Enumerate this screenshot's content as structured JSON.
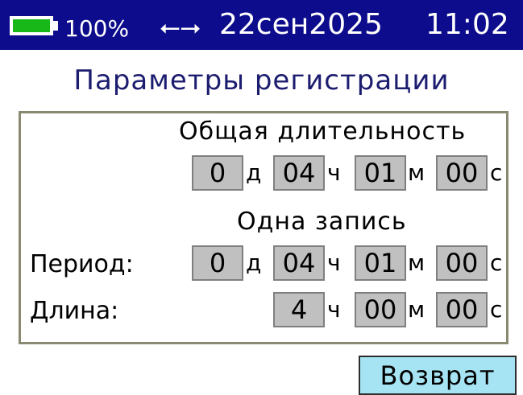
{
  "status_bar": {
    "battery_level": 1.0,
    "battery_text": "100%",
    "usb_icon": "usb-icon",
    "date": "22сен2025",
    "time": "11:02",
    "colors": {
      "background": "#0c0c8c",
      "battery_fill": "#18b818"
    }
  },
  "screen": {
    "title": "Параметры регистрации"
  },
  "total_duration": {
    "heading": "Общая длительность",
    "days": "0",
    "days_unit": "д",
    "hours": "04",
    "hours_unit": "ч",
    "minutes": "01",
    "minutes_unit": "м",
    "seconds": "00",
    "seconds_unit": "с"
  },
  "single_record": {
    "heading": "Одна запись",
    "period": {
      "label": "Период:",
      "days": "0",
      "days_unit": "д",
      "hours": "04",
      "hours_unit": "ч",
      "minutes": "01",
      "minutes_unit": "м",
      "seconds": "00",
      "seconds_unit": "с"
    },
    "length": {
      "label": "Длина:",
      "hours": "4",
      "hours_unit": "ч",
      "minutes": "00",
      "minutes_unit": "м",
      "seconds": "00",
      "seconds_unit": "с"
    }
  },
  "actions": {
    "return_label": "Возврат"
  }
}
